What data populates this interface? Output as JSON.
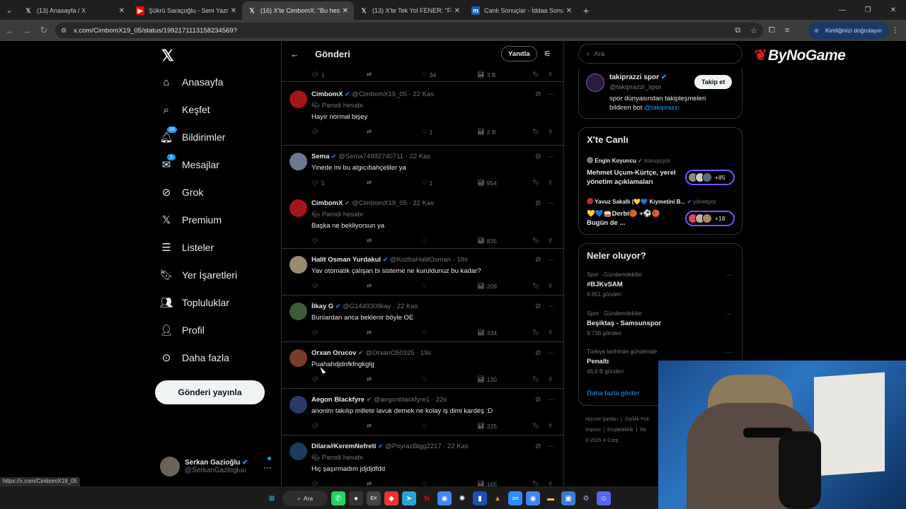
{
  "browser": {
    "tabs": [
      {
        "title": "(13) Anasayfa / X",
        "icon": "x-logo-icon"
      },
      {
        "title": "Şükrü Saraçoğlu - Seni Yazdım",
        "icon": "youtube-icon"
      },
      {
        "title": "(16) X'te CimbomX: \"Bu hesab",
        "icon": "x-logo-icon",
        "active": true
      },
      {
        "title": "(13) X'te Tek Yol FENER: \"Fener",
        "icon": "x-logo-icon"
      },
      {
        "title": "Canlı Sonuçlar - İddaa Sonuçlar",
        "icon": "m-logo-icon"
      }
    ],
    "url": "x.com/CimbomX19_05/status/1992171113158234569?",
    "verify_label": "Kimliğinizi doğrulayın",
    "status_url": "https://x.com/CimbomX19_05"
  },
  "nav": {
    "items": [
      {
        "label": "Anasayfa",
        "icon": "home-icon"
      },
      {
        "label": "Keşfet",
        "icon": "search-icon"
      },
      {
        "label": "Bildirimler",
        "icon": "bell-icon",
        "badge": "15"
      },
      {
        "label": "Mesajlar",
        "icon": "mail-icon",
        "badge": "1"
      },
      {
        "label": "Grok",
        "icon": "grok-icon"
      },
      {
        "label": "Premium",
        "icon": "x-premium-icon"
      },
      {
        "label": "Listeler",
        "icon": "list-icon"
      },
      {
        "label": "Yer İşaretleri",
        "icon": "bookmark-icon"
      },
      {
        "label": "Topluluklar",
        "icon": "communities-icon"
      },
      {
        "label": "Profil",
        "icon": "person-icon"
      },
      {
        "label": "Daha fazla",
        "icon": "more-circle-icon"
      }
    ],
    "post_button": "Gönderi yayınla",
    "account": {
      "name": "Serkan Gazioğlu",
      "handle": "@SerkanGazlogluu"
    }
  },
  "header": {
    "title": "Gönderi",
    "reply_label": "Yanıtla"
  },
  "top_actions": {
    "replies": "1",
    "likes": "34",
    "views": "3 B"
  },
  "posts": [
    {
      "name": "CimbomX",
      "handle": "@CimbomX19_05 · 22 Kas",
      "parody": "Parodi hesabı",
      "text": "Hayır normal bişey",
      "replies": "",
      "likes": "1",
      "views": "2 B",
      "avatar_color": "#a3161a"
    },
    {
      "name": "Sema",
      "handle": "@Sema74992740711 · 22 Kas",
      "parody": "",
      "text": "Yinede mi bu algıcıbahçeliler ya",
      "replies": "1",
      "likes": "1",
      "views": "954",
      "avatar_color": "#6b7a8f"
    },
    {
      "name": "CimbomX",
      "handle": "@CimbomX19_05 · 22 Kas",
      "parody": "Parodi hesabı",
      "text": "Başka ne bekliyorsun ya",
      "replies": "",
      "likes": "",
      "views": "835",
      "avatar_color": "#a3161a"
    },
    {
      "name": "Halit Osman Yurdakul",
      "handle": "@KozbaHalitOsman · 18s",
      "parody": "",
      "text": "Yav otomatik çalışan bi sisteme ne kuruldunuz bu kadar?",
      "replies": "",
      "likes": "",
      "views": "209",
      "avatar_color": "#9a8a70"
    },
    {
      "name": "İlkay G",
      "handle": "@G144930Ilkay · 22 Kas",
      "parody": "",
      "text": "Bunlardan anca beklenir böyle OE",
      "replies": "",
      "likes": "",
      "views": "334",
      "avatar_color": "#3e5a3a"
    },
    {
      "name": "Orxan Orucov",
      "handle": "@OrxanO50325 · 19s",
      "parody": "",
      "text": "Puahahdjdnfkfngkglg",
      "replies": "",
      "likes": "",
      "views": "130",
      "avatar_color": "#7a3a2a"
    },
    {
      "name": "Aegon Blackfyre",
      "handle": "@aegonblackfyre1 · 22s",
      "parody": "",
      "text": "anonim takılıp millete lavuk demek ne kolay iş dimi kardeş :D",
      "replies": "",
      "likes": "",
      "views": "225",
      "avatar_color": "#2a3a6a"
    },
    {
      "name": "Dilara#KeremNefreti",
      "handle": "@PoyrazBigg2217 · 22 Kas",
      "parody": "Parodi hesabı",
      "text": "Hiç şaşırmadım jdjdjdfdd",
      "replies": "",
      "likes": "",
      "views": "165",
      "avatar_color": "#1d3a5f"
    }
  ],
  "right": {
    "search_placeholder": "Ara",
    "follow_card": {
      "name": "takiprazzi spor",
      "handle": "@takiprazzi_spor",
      "desc": "spor dünyasından takipleşmeleri bildiren bot",
      "mention": "@takiprazzi",
      "button": "Takip et"
    },
    "live": {
      "title": "X'te Canlı",
      "items": [
        {
          "host": "Engin Koyuncu",
          "role": "konuşuyor",
          "title": "Mehmet Uçum-Kürtçe, yerel yönetim açıklamaları",
          "count": "+85"
        },
        {
          "host": "Yavuz Sakallı (💛💙 Kıymetini B...",
          "role": "yönetiyor",
          "title": "💛💙🥁Derbi🏀 +⚽🏀 Bugün de ...",
          "count": "+18"
        }
      ]
    },
    "trends": {
      "title": "Neler oluyor?",
      "items": [
        {
          "category": "Spor · Gündemdekiler",
          "name": "#BJKvSAM",
          "count": "6.951 gönderi"
        },
        {
          "category": "Spor · Gündemdekiler",
          "name": "Beşiktaş - Samsunspor",
          "count": "9.738 gönderi"
        },
        {
          "category": "Türkiye tarihinde gündemde",
          "name": "Penaltı",
          "count": "46,6 B gönderi"
        }
      ],
      "show_more": "Daha fazla göster"
    },
    "footer": [
      "Hizmet Şartları",
      "Gizlilik Poli",
      "Imprint",
      "Erişilebilirlik",
      "Re",
      "© 2025 X Corp."
    ]
  },
  "overlay": {
    "brand": "ByNoGame"
  },
  "taskbar": {
    "search_label": "Ara"
  },
  "colors": {
    "accent": "#1d9bf0",
    "bg": "#000000",
    "border": "#2f3336",
    "muted": "#71767b"
  }
}
